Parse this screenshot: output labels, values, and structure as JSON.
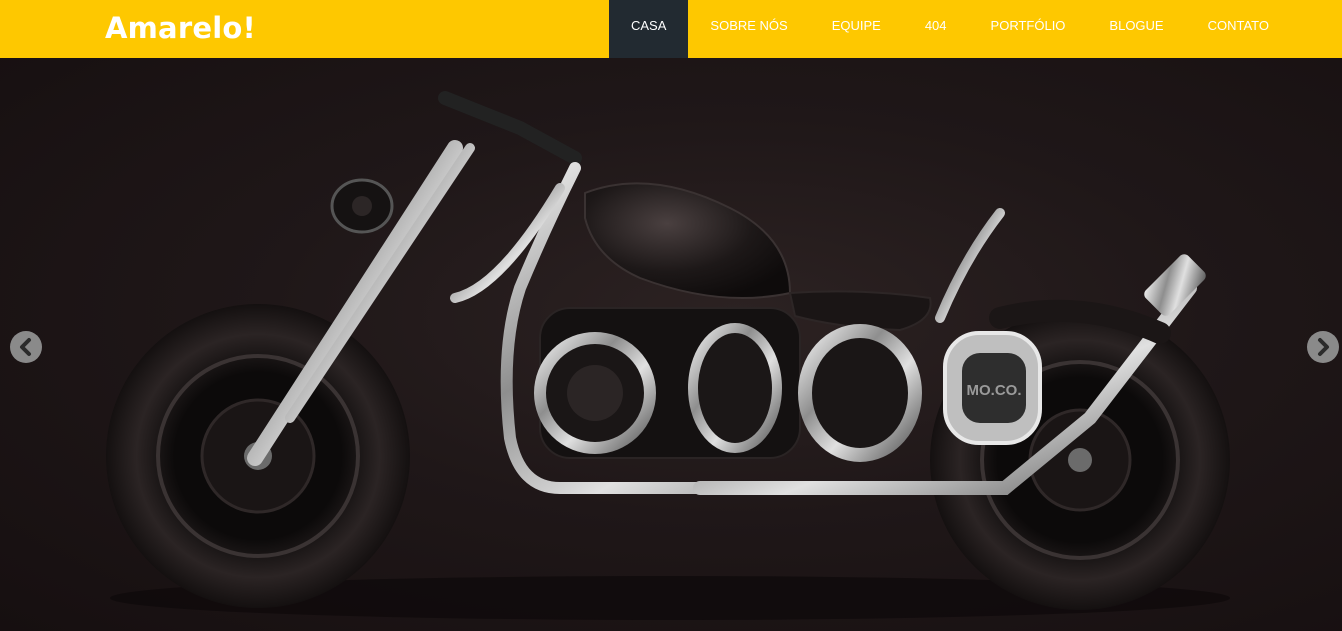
{
  "header": {
    "brand": "Amarelo!",
    "nav": [
      {
        "label": "CASA",
        "active": true
      },
      {
        "label": "SOBRE NÓS",
        "active": false
      },
      {
        "label": "EQUIPE",
        "active": false
      },
      {
        "label": "404",
        "active": false
      },
      {
        "label": "PORTFÓLIO",
        "active": false
      },
      {
        "label": "BLOGUE",
        "active": false
      },
      {
        "label": "CONTATO",
        "active": false
      }
    ]
  },
  "hero": {
    "badge_text": "MO.CO.",
    "prev_icon": "chevron-left-icon",
    "next_icon": "chevron-right-icon"
  },
  "colors": {
    "accent": "#fec800",
    "nav_active_bg": "#222a31",
    "hero_bg": "#1b1415"
  }
}
